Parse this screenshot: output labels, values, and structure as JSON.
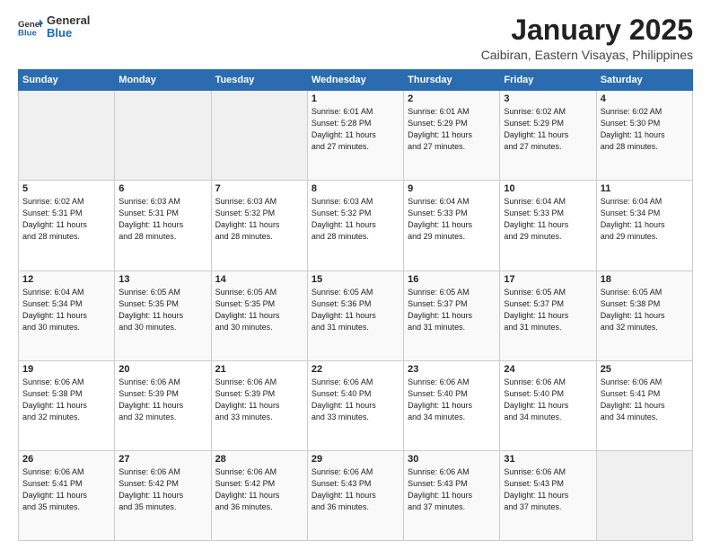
{
  "logo": {
    "general": "General",
    "blue": "Blue"
  },
  "header": {
    "title": "January 2025",
    "subtitle": "Caibiran, Eastern Visayas, Philippines"
  },
  "days_of_week": [
    "Sunday",
    "Monday",
    "Tuesday",
    "Wednesday",
    "Thursday",
    "Friday",
    "Saturday"
  ],
  "weeks": [
    [
      {
        "day": "",
        "info": ""
      },
      {
        "day": "",
        "info": ""
      },
      {
        "day": "",
        "info": ""
      },
      {
        "day": "1",
        "info": "Sunrise: 6:01 AM\nSunset: 5:28 PM\nDaylight: 11 hours\nand 27 minutes."
      },
      {
        "day": "2",
        "info": "Sunrise: 6:01 AM\nSunset: 5:29 PM\nDaylight: 11 hours\nand 27 minutes."
      },
      {
        "day": "3",
        "info": "Sunrise: 6:02 AM\nSunset: 5:29 PM\nDaylight: 11 hours\nand 27 minutes."
      },
      {
        "day": "4",
        "info": "Sunrise: 6:02 AM\nSunset: 5:30 PM\nDaylight: 11 hours\nand 28 minutes."
      }
    ],
    [
      {
        "day": "5",
        "info": "Sunrise: 6:02 AM\nSunset: 5:31 PM\nDaylight: 11 hours\nand 28 minutes."
      },
      {
        "day": "6",
        "info": "Sunrise: 6:03 AM\nSunset: 5:31 PM\nDaylight: 11 hours\nand 28 minutes."
      },
      {
        "day": "7",
        "info": "Sunrise: 6:03 AM\nSunset: 5:32 PM\nDaylight: 11 hours\nand 28 minutes."
      },
      {
        "day": "8",
        "info": "Sunrise: 6:03 AM\nSunset: 5:32 PM\nDaylight: 11 hours\nand 28 minutes."
      },
      {
        "day": "9",
        "info": "Sunrise: 6:04 AM\nSunset: 5:33 PM\nDaylight: 11 hours\nand 29 minutes."
      },
      {
        "day": "10",
        "info": "Sunrise: 6:04 AM\nSunset: 5:33 PM\nDaylight: 11 hours\nand 29 minutes."
      },
      {
        "day": "11",
        "info": "Sunrise: 6:04 AM\nSunset: 5:34 PM\nDaylight: 11 hours\nand 29 minutes."
      }
    ],
    [
      {
        "day": "12",
        "info": "Sunrise: 6:04 AM\nSunset: 5:34 PM\nDaylight: 11 hours\nand 30 minutes."
      },
      {
        "day": "13",
        "info": "Sunrise: 6:05 AM\nSunset: 5:35 PM\nDaylight: 11 hours\nand 30 minutes."
      },
      {
        "day": "14",
        "info": "Sunrise: 6:05 AM\nSunset: 5:35 PM\nDaylight: 11 hours\nand 30 minutes."
      },
      {
        "day": "15",
        "info": "Sunrise: 6:05 AM\nSunset: 5:36 PM\nDaylight: 11 hours\nand 31 minutes."
      },
      {
        "day": "16",
        "info": "Sunrise: 6:05 AM\nSunset: 5:37 PM\nDaylight: 11 hours\nand 31 minutes."
      },
      {
        "day": "17",
        "info": "Sunrise: 6:05 AM\nSunset: 5:37 PM\nDaylight: 11 hours\nand 31 minutes."
      },
      {
        "day": "18",
        "info": "Sunrise: 6:05 AM\nSunset: 5:38 PM\nDaylight: 11 hours\nand 32 minutes."
      }
    ],
    [
      {
        "day": "19",
        "info": "Sunrise: 6:06 AM\nSunset: 5:38 PM\nDaylight: 11 hours\nand 32 minutes."
      },
      {
        "day": "20",
        "info": "Sunrise: 6:06 AM\nSunset: 5:39 PM\nDaylight: 11 hours\nand 32 minutes."
      },
      {
        "day": "21",
        "info": "Sunrise: 6:06 AM\nSunset: 5:39 PM\nDaylight: 11 hours\nand 33 minutes."
      },
      {
        "day": "22",
        "info": "Sunrise: 6:06 AM\nSunset: 5:40 PM\nDaylight: 11 hours\nand 33 minutes."
      },
      {
        "day": "23",
        "info": "Sunrise: 6:06 AM\nSunset: 5:40 PM\nDaylight: 11 hours\nand 34 minutes."
      },
      {
        "day": "24",
        "info": "Sunrise: 6:06 AM\nSunset: 5:40 PM\nDaylight: 11 hours\nand 34 minutes."
      },
      {
        "day": "25",
        "info": "Sunrise: 6:06 AM\nSunset: 5:41 PM\nDaylight: 11 hours\nand 34 minutes."
      }
    ],
    [
      {
        "day": "26",
        "info": "Sunrise: 6:06 AM\nSunset: 5:41 PM\nDaylight: 11 hours\nand 35 minutes."
      },
      {
        "day": "27",
        "info": "Sunrise: 6:06 AM\nSunset: 5:42 PM\nDaylight: 11 hours\nand 35 minutes."
      },
      {
        "day": "28",
        "info": "Sunrise: 6:06 AM\nSunset: 5:42 PM\nDaylight: 11 hours\nand 36 minutes."
      },
      {
        "day": "29",
        "info": "Sunrise: 6:06 AM\nSunset: 5:43 PM\nDaylight: 11 hours\nand 36 minutes."
      },
      {
        "day": "30",
        "info": "Sunrise: 6:06 AM\nSunset: 5:43 PM\nDaylight: 11 hours\nand 37 minutes."
      },
      {
        "day": "31",
        "info": "Sunrise: 6:06 AM\nSunset: 5:43 PM\nDaylight: 11 hours\nand 37 minutes."
      },
      {
        "day": "",
        "info": ""
      }
    ]
  ]
}
